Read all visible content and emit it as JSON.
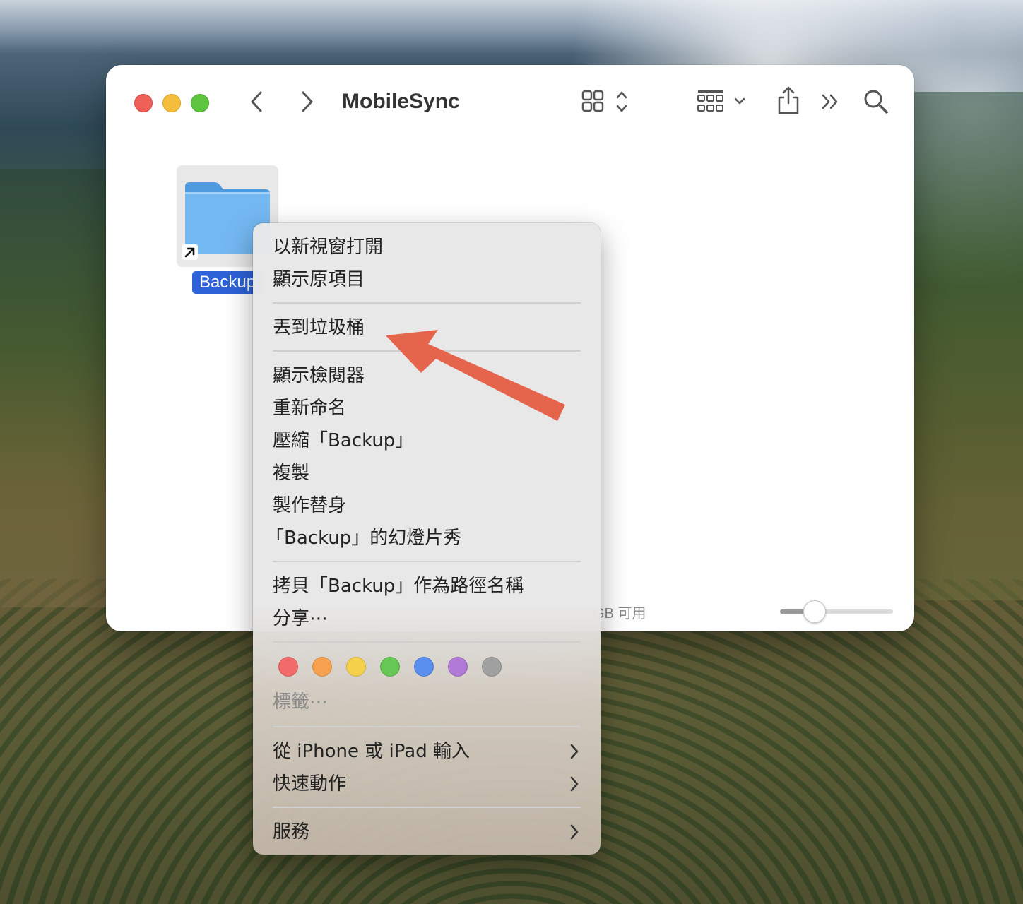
{
  "window": {
    "title": "MobileSync",
    "status": "GB 可用",
    "icon_size_level": 0.25
  },
  "toolbar": {
    "icons": [
      "back-icon",
      "forward-icon",
      "icon-view-icon",
      "group-by-icon",
      "share-icon",
      "more-icon",
      "search-icon"
    ]
  },
  "folder": {
    "name": "Backup",
    "color": "#6fb5f0"
  },
  "menu": {
    "items": [
      {
        "label": "以新視窗打開"
      },
      {
        "label": "顯示原項目"
      },
      {
        "label": "丟到垃圾桶"
      },
      {
        "label": "顯示檢閱器"
      },
      {
        "label": "重新命名"
      },
      {
        "label": "壓縮「Backup」"
      },
      {
        "label": "複製"
      },
      {
        "label": "製作替身"
      },
      {
        "label": "「Backup」的幻燈片秀"
      },
      {
        "label": "拷貝「Backup」作為路徑名稱"
      },
      {
        "label": "分享⋯"
      },
      {
        "label": "標籤⋯"
      },
      {
        "label": "從 iPhone 或 iPad 輸入"
      },
      {
        "label": "快速動作"
      },
      {
        "label": "服務"
      }
    ],
    "tag_colors": [
      "#f26b6b",
      "#f7a14f",
      "#f5d04b",
      "#67c855",
      "#5a8ff0",
      "#b07ad6",
      "#a0a0a0"
    ]
  },
  "annotation": {
    "arrow_color": "#e5644c"
  }
}
